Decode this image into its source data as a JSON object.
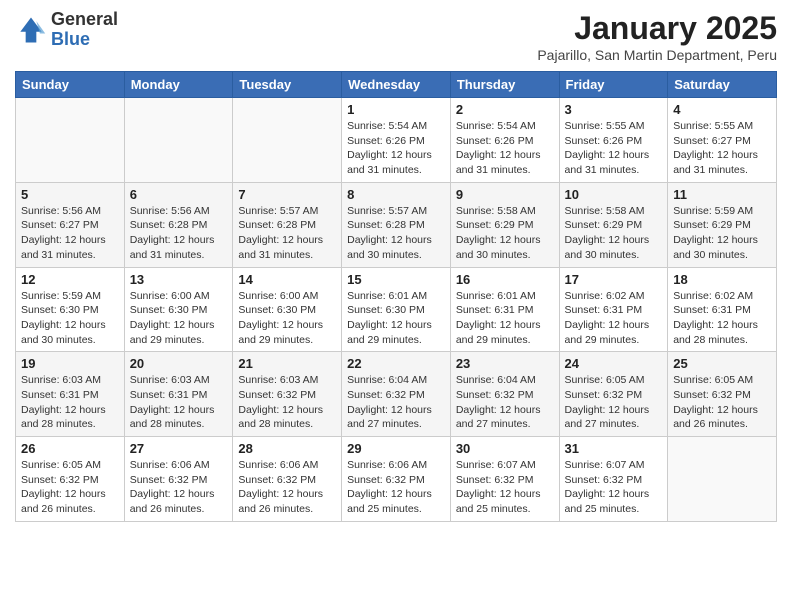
{
  "header": {
    "logo_general": "General",
    "logo_blue": "Blue",
    "month_title": "January 2025",
    "location": "Pajarillo, San Martin Department, Peru"
  },
  "weekdays": [
    "Sunday",
    "Monday",
    "Tuesday",
    "Wednesday",
    "Thursday",
    "Friday",
    "Saturday"
  ],
  "weeks": [
    [
      {
        "day": "",
        "info": ""
      },
      {
        "day": "",
        "info": ""
      },
      {
        "day": "",
        "info": ""
      },
      {
        "day": "1",
        "info": "Sunrise: 5:54 AM\nSunset: 6:26 PM\nDaylight: 12 hours\nand 31 minutes."
      },
      {
        "day": "2",
        "info": "Sunrise: 5:54 AM\nSunset: 6:26 PM\nDaylight: 12 hours\nand 31 minutes."
      },
      {
        "day": "3",
        "info": "Sunrise: 5:55 AM\nSunset: 6:26 PM\nDaylight: 12 hours\nand 31 minutes."
      },
      {
        "day": "4",
        "info": "Sunrise: 5:55 AM\nSunset: 6:27 PM\nDaylight: 12 hours\nand 31 minutes."
      }
    ],
    [
      {
        "day": "5",
        "info": "Sunrise: 5:56 AM\nSunset: 6:27 PM\nDaylight: 12 hours\nand 31 minutes."
      },
      {
        "day": "6",
        "info": "Sunrise: 5:56 AM\nSunset: 6:28 PM\nDaylight: 12 hours\nand 31 minutes."
      },
      {
        "day": "7",
        "info": "Sunrise: 5:57 AM\nSunset: 6:28 PM\nDaylight: 12 hours\nand 31 minutes."
      },
      {
        "day": "8",
        "info": "Sunrise: 5:57 AM\nSunset: 6:28 PM\nDaylight: 12 hours\nand 30 minutes."
      },
      {
        "day": "9",
        "info": "Sunrise: 5:58 AM\nSunset: 6:29 PM\nDaylight: 12 hours\nand 30 minutes."
      },
      {
        "day": "10",
        "info": "Sunrise: 5:58 AM\nSunset: 6:29 PM\nDaylight: 12 hours\nand 30 minutes."
      },
      {
        "day": "11",
        "info": "Sunrise: 5:59 AM\nSunset: 6:29 PM\nDaylight: 12 hours\nand 30 minutes."
      }
    ],
    [
      {
        "day": "12",
        "info": "Sunrise: 5:59 AM\nSunset: 6:30 PM\nDaylight: 12 hours\nand 30 minutes."
      },
      {
        "day": "13",
        "info": "Sunrise: 6:00 AM\nSunset: 6:30 PM\nDaylight: 12 hours\nand 29 minutes."
      },
      {
        "day": "14",
        "info": "Sunrise: 6:00 AM\nSunset: 6:30 PM\nDaylight: 12 hours\nand 29 minutes."
      },
      {
        "day": "15",
        "info": "Sunrise: 6:01 AM\nSunset: 6:30 PM\nDaylight: 12 hours\nand 29 minutes."
      },
      {
        "day": "16",
        "info": "Sunrise: 6:01 AM\nSunset: 6:31 PM\nDaylight: 12 hours\nand 29 minutes."
      },
      {
        "day": "17",
        "info": "Sunrise: 6:02 AM\nSunset: 6:31 PM\nDaylight: 12 hours\nand 29 minutes."
      },
      {
        "day": "18",
        "info": "Sunrise: 6:02 AM\nSunset: 6:31 PM\nDaylight: 12 hours\nand 28 minutes."
      }
    ],
    [
      {
        "day": "19",
        "info": "Sunrise: 6:03 AM\nSunset: 6:31 PM\nDaylight: 12 hours\nand 28 minutes."
      },
      {
        "day": "20",
        "info": "Sunrise: 6:03 AM\nSunset: 6:31 PM\nDaylight: 12 hours\nand 28 minutes."
      },
      {
        "day": "21",
        "info": "Sunrise: 6:03 AM\nSunset: 6:32 PM\nDaylight: 12 hours\nand 28 minutes."
      },
      {
        "day": "22",
        "info": "Sunrise: 6:04 AM\nSunset: 6:32 PM\nDaylight: 12 hours\nand 27 minutes."
      },
      {
        "day": "23",
        "info": "Sunrise: 6:04 AM\nSunset: 6:32 PM\nDaylight: 12 hours\nand 27 minutes."
      },
      {
        "day": "24",
        "info": "Sunrise: 6:05 AM\nSunset: 6:32 PM\nDaylight: 12 hours\nand 27 minutes."
      },
      {
        "day": "25",
        "info": "Sunrise: 6:05 AM\nSunset: 6:32 PM\nDaylight: 12 hours\nand 26 minutes."
      }
    ],
    [
      {
        "day": "26",
        "info": "Sunrise: 6:05 AM\nSunset: 6:32 PM\nDaylight: 12 hours\nand 26 minutes."
      },
      {
        "day": "27",
        "info": "Sunrise: 6:06 AM\nSunset: 6:32 PM\nDaylight: 12 hours\nand 26 minutes."
      },
      {
        "day": "28",
        "info": "Sunrise: 6:06 AM\nSunset: 6:32 PM\nDaylight: 12 hours\nand 26 minutes."
      },
      {
        "day": "29",
        "info": "Sunrise: 6:06 AM\nSunset: 6:32 PM\nDaylight: 12 hours\nand 25 minutes."
      },
      {
        "day": "30",
        "info": "Sunrise: 6:07 AM\nSunset: 6:32 PM\nDaylight: 12 hours\nand 25 minutes."
      },
      {
        "day": "31",
        "info": "Sunrise: 6:07 AM\nSunset: 6:32 PM\nDaylight: 12 hours\nand 25 minutes."
      },
      {
        "day": "",
        "info": ""
      }
    ]
  ]
}
